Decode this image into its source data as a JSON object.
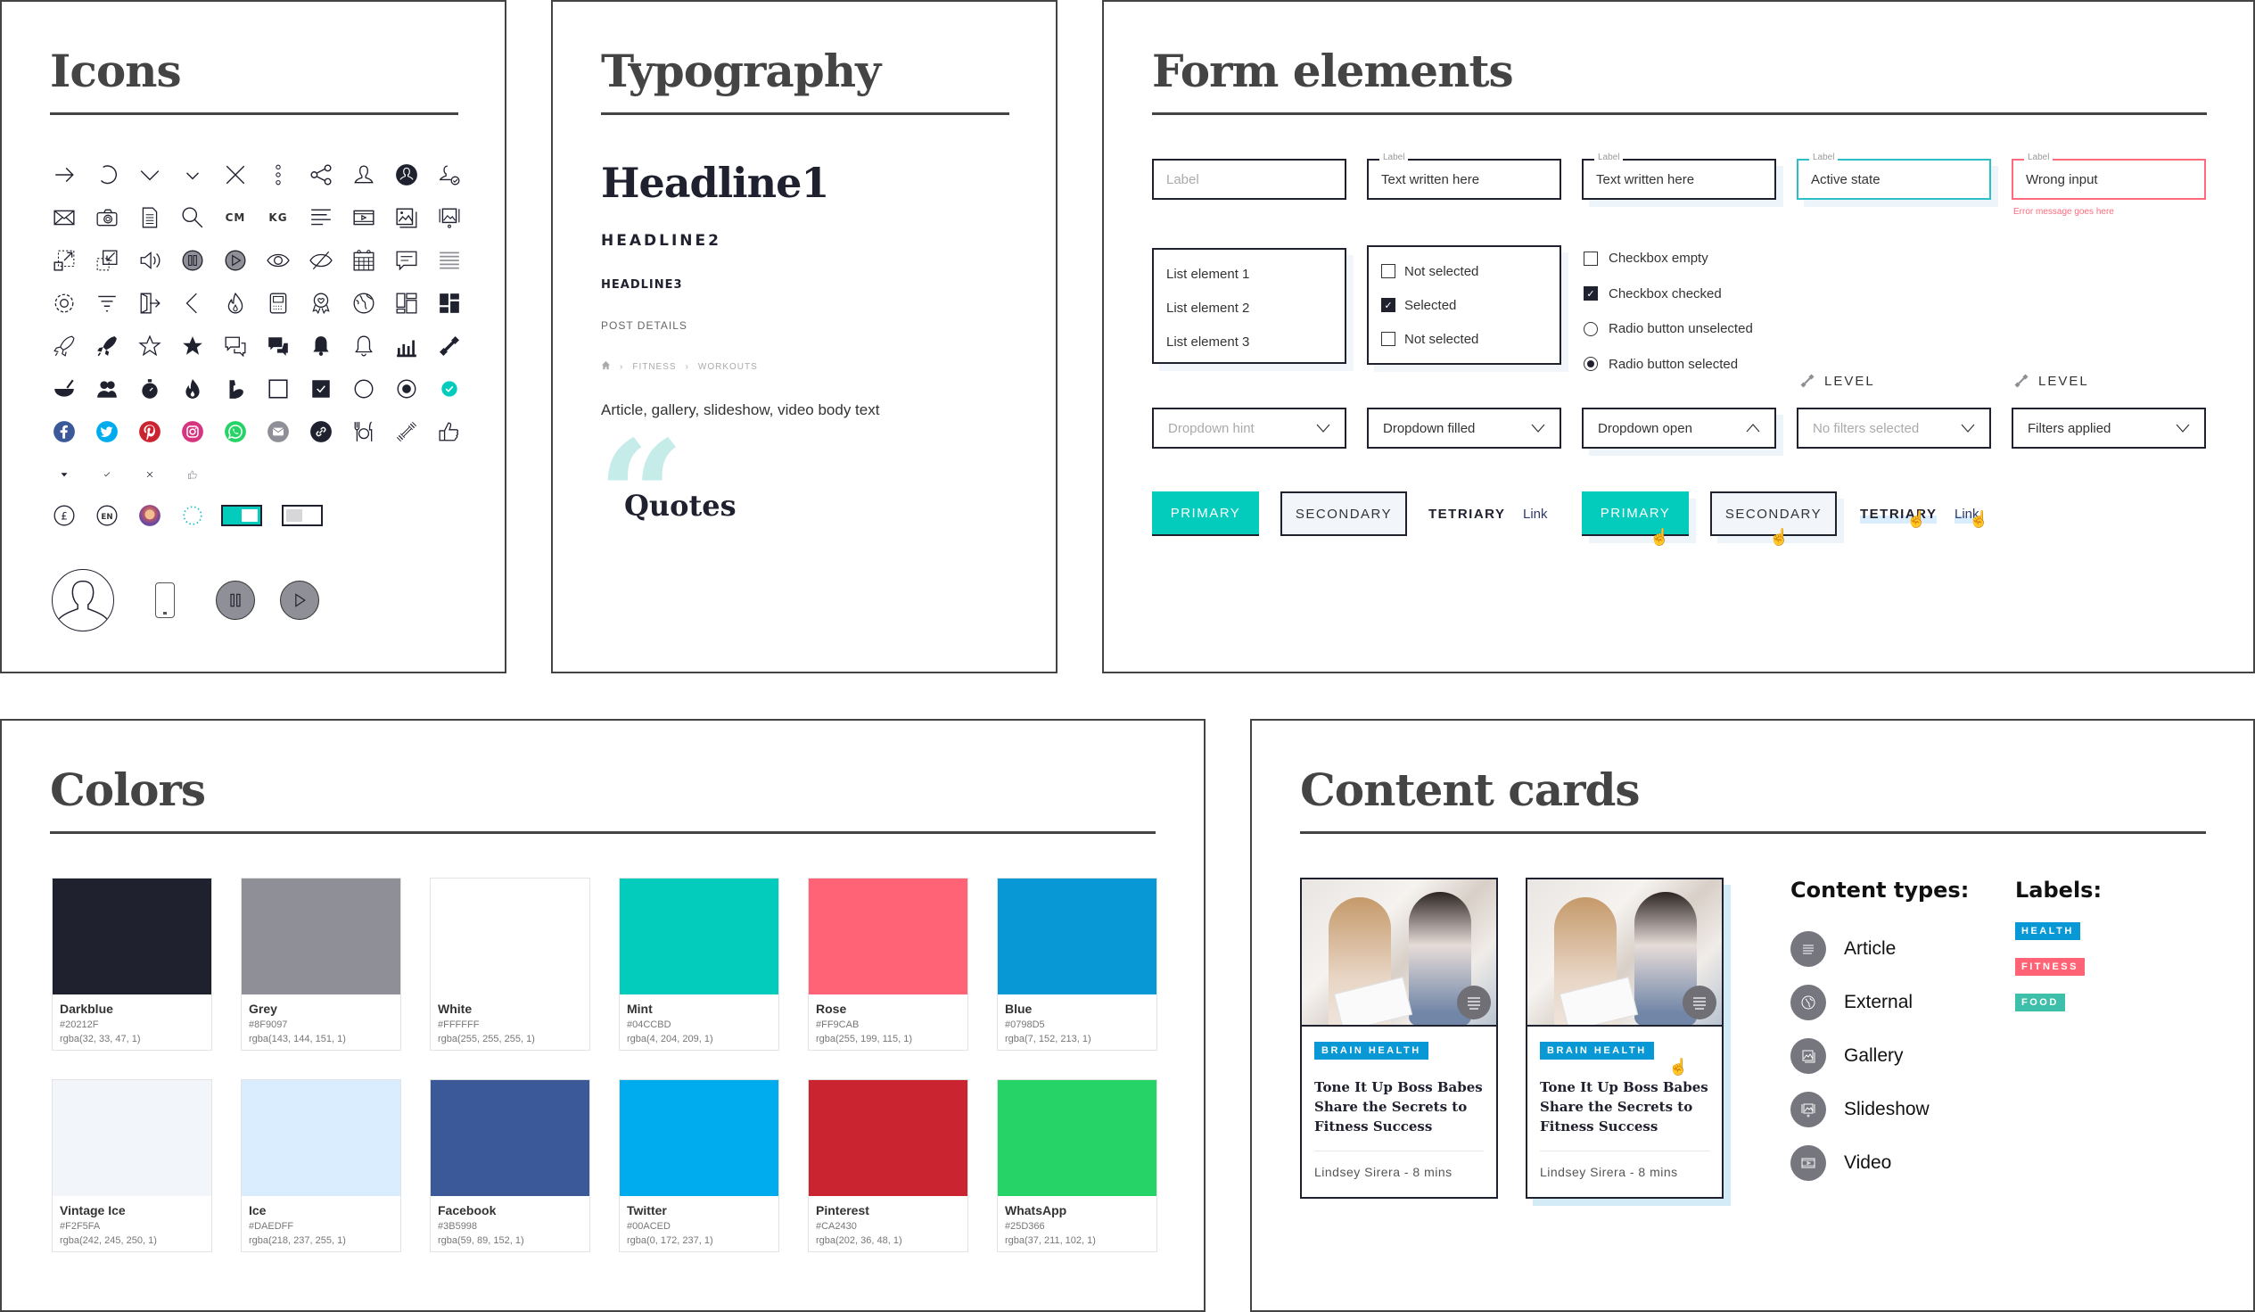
{
  "panels": {
    "icons": {
      "title": "Icons"
    },
    "typography": {
      "title": "Typography"
    },
    "forms": {
      "title": "Form elements"
    },
    "colors": {
      "title": "Colors"
    },
    "cards": {
      "title": "Content cards"
    }
  },
  "icons": {
    "grid": [
      "arrow-right-icon",
      "refresh-icon",
      "chevron-down-icon",
      "chevron-down-small-icon",
      "close-icon",
      "more-vertical-icon",
      "share-icon",
      "user-icon",
      "user-filled-icon",
      "user-check-icon",
      "mail-icon",
      "camera-icon",
      "document-icon",
      "search-icon",
      "cm-unit-icon",
      "kg-unit-icon",
      "text-align-icon",
      "video-icon",
      "gallery-icon",
      "slideshow-icon",
      "expand-icon",
      "collapse-icon",
      "volume-icon",
      "pause-icon",
      "play-icon",
      "eye-icon",
      "eye-off-icon",
      "calendar-icon",
      "comment-icon",
      "menu-icon",
      "settings-icon",
      "filter-icon",
      "logout-icon",
      "chevron-left-icon",
      "flame-outline-icon",
      "calculator-icon",
      "award-icon",
      "globe-icon",
      "layout-outline-icon",
      "layout-filled-icon",
      "rocket-outline-icon",
      "rocket-filled-icon",
      "star-outline-icon",
      "star-filled-icon",
      "chat-outline-icon",
      "chat-filled-icon",
      "bell-filled-icon",
      "bell-outline-icon",
      "bar-chart-icon",
      "dumbbell-filled-icon",
      "bowl-icon",
      "users-icon",
      "stopwatch-icon",
      "flame-filled-icon",
      "muscle-icon",
      "checkbox-empty-icon",
      "checkbox-checked-icon",
      "radio-empty-icon",
      "radio-selected-icon",
      "check-circle-mint-icon",
      "facebook-icon",
      "twitter-icon",
      "pinterest-icon",
      "instagram-icon",
      "whatsapp-icon",
      "email-share-icon",
      "link-icon",
      "dining-icon",
      "dumbbell-outline-icon",
      "thumbs-up-icon",
      "caret-down-icon",
      "check-small-icon",
      "close-small-icon",
      "thumbs-up-small-icon"
    ],
    "text_icons": {
      "cm": "CM",
      "kg": "KG"
    },
    "misc": {
      "currency": "£",
      "language": "EN"
    }
  },
  "typography": {
    "headline1": "Headline1",
    "headline2": "HEADLINE2",
    "headline3": "HEADLINE3",
    "post_details": "POST DETAILS",
    "breadcrumb": [
      "FITNESS",
      "WORKOUTS"
    ],
    "body": "Article, gallery, slideshow, video body text",
    "quote_mark": "“",
    "quote": "Quotes"
  },
  "forms": {
    "inputs": [
      {
        "label": "",
        "value": "Label",
        "state": "placeholder"
      },
      {
        "label": "Label",
        "value": "Text written here",
        "state": "filled"
      },
      {
        "label": "Label",
        "value": "Text written here",
        "state": "focused"
      },
      {
        "label": "Label",
        "value": "Active state",
        "state": "active"
      },
      {
        "label": "Label",
        "value": "Wrong input",
        "state": "error",
        "error": "Error message goes here"
      }
    ],
    "list": [
      "List element 1",
      "List element 2",
      "List element 3"
    ],
    "checklist": [
      {
        "label": "Not selected",
        "checked": false
      },
      {
        "label": "Selected",
        "checked": true
      },
      {
        "label": "Not selected",
        "checked": false
      }
    ],
    "controls": [
      {
        "label": "Checkbox empty",
        "type": "checkbox",
        "checked": false
      },
      {
        "label": "Checkbox checked",
        "type": "checkbox",
        "checked": true
      },
      {
        "label": "Radio button unselected",
        "type": "radio",
        "checked": false
      },
      {
        "label": "Radio button selected",
        "type": "radio",
        "checked": true
      }
    ],
    "level_label": "LEVEL",
    "dropdowns": [
      {
        "value": "Dropdown hint",
        "state": "hint"
      },
      {
        "value": "Dropdown filled",
        "state": "filled"
      },
      {
        "value": "Dropdown open",
        "state": "open"
      },
      {
        "value": "No filters selected",
        "state": "hint"
      },
      {
        "value": "Filters applied",
        "state": "filled"
      }
    ],
    "buttons": {
      "primary": "PRIMARY",
      "secondary": "SECONDARY",
      "tertiary": "TETRIARY",
      "link": "Link"
    }
  },
  "colors": [
    {
      "name": "Darkblue",
      "hex": "#20212F",
      "rgba": "rgba(32, 33, 47, 1)"
    },
    {
      "name": "Grey",
      "hex": "#8F9097",
      "rgba": "rgba(143, 144, 151, 1)"
    },
    {
      "name": "White",
      "hex": "#FFFFFF",
      "rgba": "rgba(255, 255, 255, 1)"
    },
    {
      "name": "Mint",
      "hex": "#04CCBD",
      "rgba": "rgba(4, 204, 209, 1)"
    },
    {
      "name": "Rose",
      "hex": "#FF9CAB",
      "rgba": "rgba(255, 199, 115, 1)",
      "display": "#FF6375"
    },
    {
      "name": "Blue",
      "hex": "#0798D5",
      "rgba": "rgba(7, 152, 213, 1)"
    },
    {
      "name": "Vintage Ice",
      "hex": "#F2F5FA",
      "rgba": "rgba(242, 245, 250, 1)"
    },
    {
      "name": "Ice",
      "hex": "#DAEDFF",
      "rgba": "rgba(218, 237, 255, 1)"
    },
    {
      "name": "Facebook",
      "hex": "#3B5998",
      "rgba": "rgba(59, 89, 152, 1)"
    },
    {
      "name": "Twitter",
      "hex": "#00ACED",
      "rgba": "rgba(0, 172, 237, 1)"
    },
    {
      "name": "Pinterest",
      "hex": "#CA2430",
      "rgba": "rgba(202, 36, 48, 1)"
    },
    {
      "name": "WhatsApp",
      "hex": "#25D366",
      "rgba": "rgba(37, 211, 102, 1)"
    }
  ],
  "cards": {
    "items": [
      {
        "label": "BRAIN HEALTH",
        "title": "Tone It Up Boss Babes Share the Secrets to Fitness Success",
        "byline": "Lindsey Sirera - 8 mins",
        "state": "default"
      },
      {
        "label": "BRAIN HEALTH",
        "title": "Tone It Up Boss Babes Share the Secrets to Fitness Success",
        "byline": "Lindsey Sirera - 8 mins",
        "state": "hover"
      }
    ],
    "content_types_title": "Content types:",
    "content_types": [
      "Article",
      "External",
      "Gallery",
      "Slideshow",
      "Video"
    ],
    "labels_title": "Labels:",
    "labels": [
      {
        "text": "HEALTH",
        "color": "#0798D5"
      },
      {
        "text": "FITNESS",
        "color": "#FF6375"
      },
      {
        "text": "FOOD",
        "color": "#3DBFAA"
      }
    ]
  }
}
